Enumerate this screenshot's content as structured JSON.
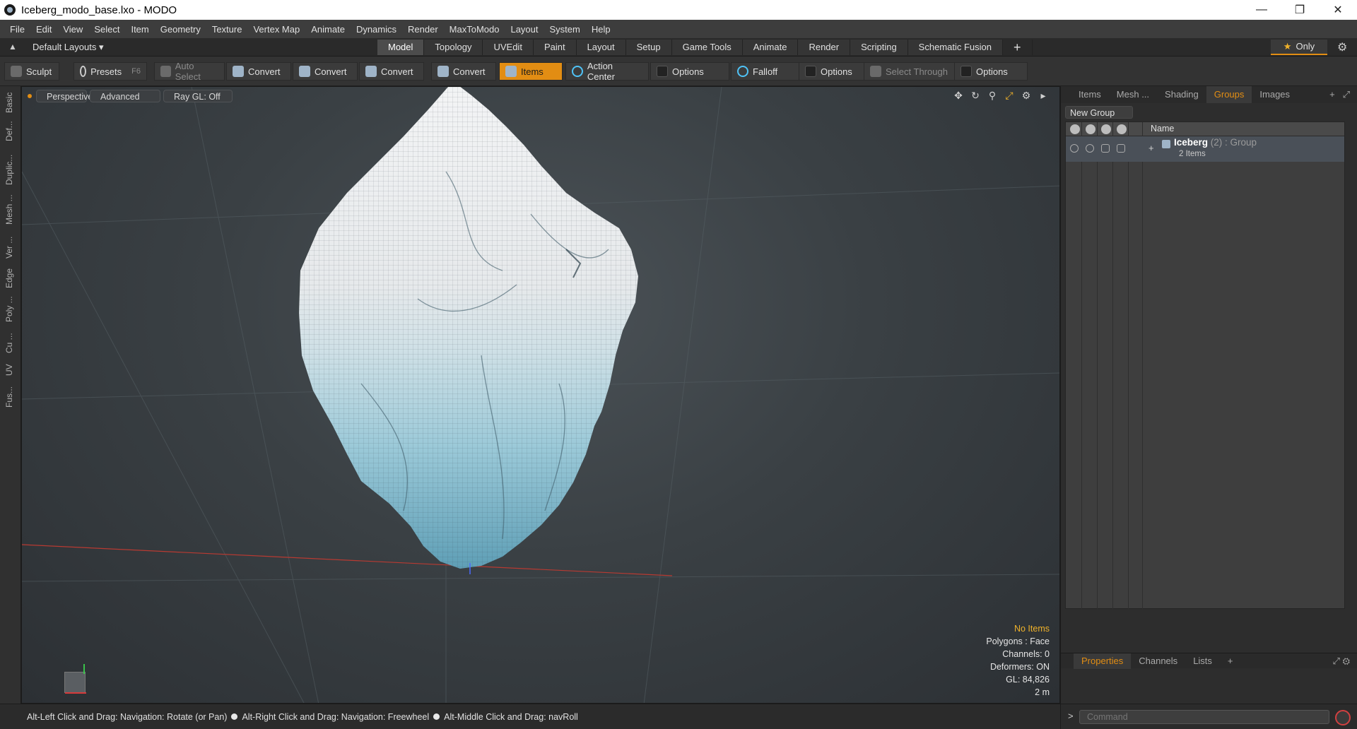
{
  "window": {
    "title": "Iceberg_modo_base.lxo - MODO"
  },
  "menu": [
    "File",
    "Edit",
    "View",
    "Select",
    "Item",
    "Geometry",
    "Texture",
    "Vertex Map",
    "Animate",
    "Dynamics",
    "Render",
    "MaxToModo",
    "Layout",
    "System",
    "Help"
  ],
  "layout_bar": {
    "layouts": "Default Layouts",
    "tabs": [
      "Model",
      "Topology",
      "UVEdit",
      "Paint",
      "Layout",
      "Setup",
      "Game Tools",
      "Animate",
      "Render",
      "Scripting",
      "Schematic Fusion"
    ],
    "active_tab": "Model",
    "add_tab": "+",
    "only": "Only"
  },
  "toolbar": {
    "sculpt": "Sculpt",
    "presets": "Presets",
    "presets_key": "F6",
    "auto_select": "Auto Select",
    "convert": "Convert",
    "items": "Items",
    "action_center": "Action Center",
    "options": "Options",
    "falloff": "Falloff",
    "select_through": "Select Through"
  },
  "left_tabs": [
    "Basic",
    "Def...",
    "Duplic...",
    "Mesh ...",
    "Ver ...",
    "Edge",
    "Poly ...",
    "Cu ...",
    "UV",
    "Fus..."
  ],
  "viewport": {
    "view": "Perspective",
    "shading": "Advanced",
    "raygl": "Ray GL: Off",
    "info": {
      "no_items": "No Items",
      "polygons": "Polygons : Face",
      "channels": "Channels: 0",
      "deformers": "Deformers: ON",
      "gl": "GL: 84,826",
      "scale": "2 m"
    }
  },
  "status": {
    "hint1": "Alt-Left Click and Drag: Navigation: Rotate (or Pan)",
    "hint2": "Alt-Right Click and Drag: Navigation: Freewheel",
    "hint3": "Alt-Middle Click and Drag: navRoll"
  },
  "right_panel": {
    "tabs": [
      "Items",
      "Mesh ...",
      "Shading",
      "Groups",
      "Images"
    ],
    "active_tab": "Groups",
    "new_group": "New Group",
    "column_name": "Name",
    "group": {
      "name": "Iceberg",
      "meta": "(2) : Group",
      "count": "2 Items"
    },
    "bottom_tabs": [
      "Properties",
      "Channels",
      "Lists"
    ],
    "bottom_active": "Properties",
    "command_prompt": ">",
    "command_placeholder": "Command"
  },
  "colors": {
    "accent": "#e28d13",
    "ice_white": "#eef0f2",
    "ice_blue": "#86c4d8"
  }
}
